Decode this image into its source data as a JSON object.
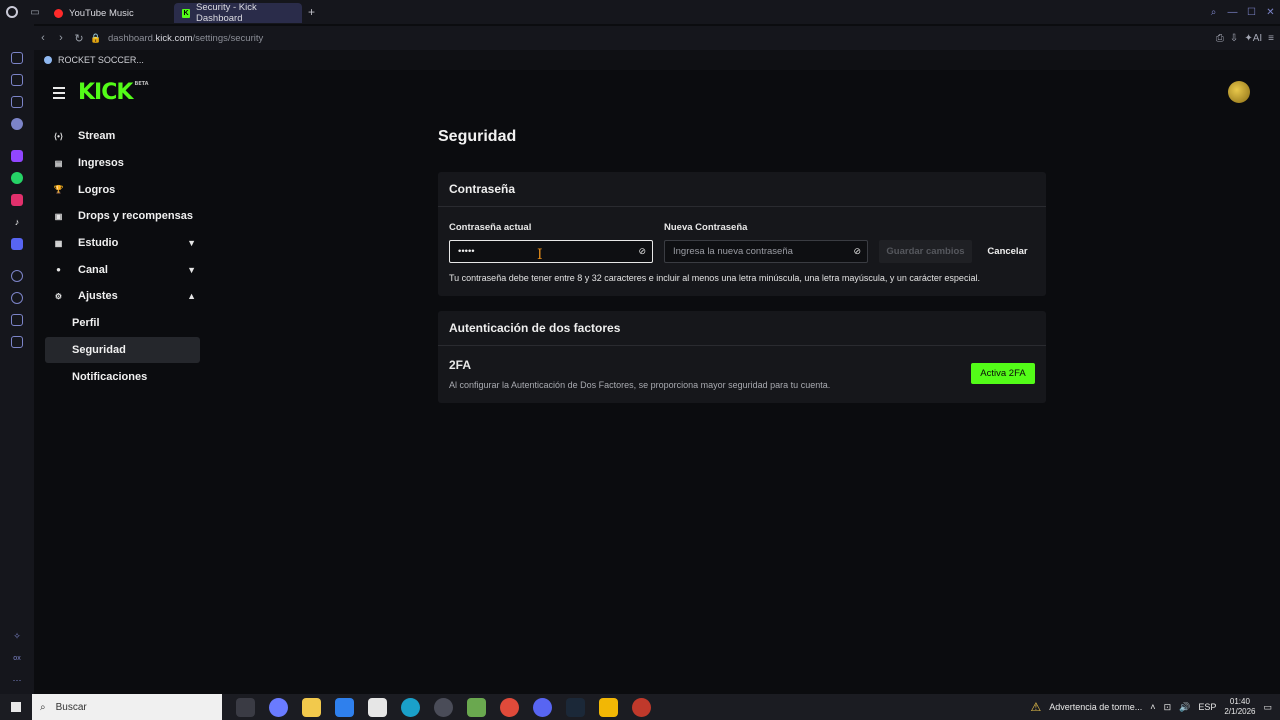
{
  "browser": {
    "tabs": [
      {
        "label": "YouTube Music",
        "active": false
      },
      {
        "label": "Security - Kick Dashboard",
        "active": true
      }
    ],
    "url_prefix": "dashboard.",
    "url_domain": "kick.com",
    "url_path": "/settings/security",
    "bookmark": "ROCKET SOCCER...",
    "ai_label": "AI"
  },
  "header": {
    "logo": "KICK",
    "logo_badge": "BETA"
  },
  "sidebar": {
    "items": [
      {
        "label": "Stream",
        "icon": "stream-icon"
      },
      {
        "label": "Ingresos",
        "icon": "revenue-icon"
      },
      {
        "label": "Logros",
        "icon": "trophy-icon"
      },
      {
        "label": "Drops y recompensas",
        "icon": "gift-icon"
      },
      {
        "label": "Estudio",
        "icon": "studio-icon"
      },
      {
        "label": "Canal",
        "icon": "channel-icon"
      },
      {
        "label": "Ajustes",
        "icon": "settings-icon"
      },
      {
        "label": "Perfil"
      },
      {
        "label": "Seguridad"
      },
      {
        "label": "Notificaciones"
      }
    ]
  },
  "main": {
    "title": "Seguridad",
    "password_card": {
      "heading": "Contraseña",
      "current_label": "Contraseña actual",
      "current_value": "•••••",
      "new_label": "Nueva Contraseña",
      "new_placeholder": "Ingresa la nueva contraseña",
      "save_label": "Guardar cambios",
      "cancel_label": "Cancelar",
      "hint": "Tu contraseña debe tener entre 8 y 32 caracteres e incluir al menos una letra minúscula, una letra mayúscula, y un carácter especial."
    },
    "twofa_card": {
      "heading": "Autenticación de dos factores",
      "title": "2FA",
      "description": "Al configurar la Autenticación de Dos Factores, se proporciona mayor seguridad para tu cuenta.",
      "button_label": "Activa 2FA"
    }
  },
  "taskbar": {
    "search_placeholder": "Buscar",
    "weather": "Advertencia de torme...",
    "language": "ESP",
    "time": "01:40",
    "date": "2/1/2026"
  },
  "colors": {
    "accent": "#53fc18",
    "background": "#0b0c0f",
    "card": "#16171b"
  }
}
